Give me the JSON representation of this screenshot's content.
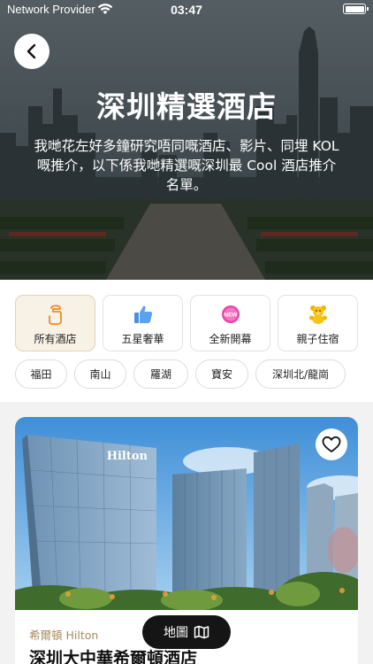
{
  "status_bar": {
    "carrier": "Network Provider",
    "time": "03:47"
  },
  "hero": {
    "title": "深圳精選酒店",
    "description": "我哋花左好多鐘研究唔同嘅酒店、影片、同埋 KOL 嘅推介，以下係我哋精選嘅深圳最 Cool 酒店推介名單。"
  },
  "categories": [
    {
      "label": "所有酒店",
      "icon": "hotel-icon",
      "active": true
    },
    {
      "label": "五星奢華",
      "icon": "thumbs-up-icon",
      "active": false
    },
    {
      "label": "全新開幕",
      "icon": "new-badge-icon",
      "active": false
    },
    {
      "label": "親子住宿",
      "icon": "teddy-bear-icon",
      "active": false
    }
  ],
  "areas": [
    "福田",
    "南山",
    "羅湖",
    "寶安",
    "深圳北/龍崗"
  ],
  "hotel_card": {
    "brand": "希爾頓 Hilton",
    "name": "深圳大中華希爾頓酒店",
    "building_sign": "Hilton",
    "favorite_icon": "heart-icon"
  },
  "map_button": {
    "label": "地圖",
    "icon": "map-icon"
  },
  "colors": {
    "accent": "#f08a24",
    "brand_text": "#a78b5e",
    "active_bg": "#f8f1e6"
  }
}
